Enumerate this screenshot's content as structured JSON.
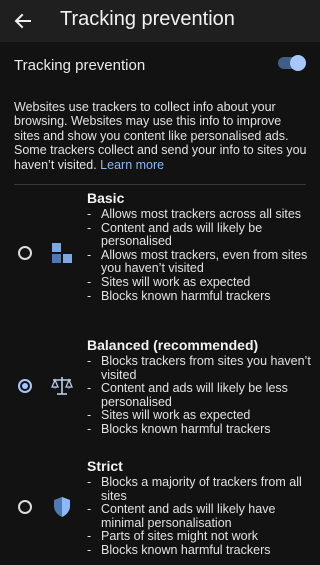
{
  "appbar": {
    "title": "Tracking prevention"
  },
  "toggle": {
    "label": "Tracking prevention",
    "on": true
  },
  "description": {
    "text": "Websites use trackers to collect info about your browsing. Websites may use this info to improve sites and show you content like personalised ads. Some trackers collect and send your info to sites you haven’t visited.",
    "link": "Learn more"
  },
  "options": [
    {
      "title": "Basic",
      "selected": false,
      "icon": "blocks-icon",
      "items": [
        "Allows most trackers across all sites",
        "Content and ads will likely be personalised",
        "Allows most trackers, even from sites you haven’t visited",
        "Sites will work as expected",
        "Blocks known harmful trackers"
      ]
    },
    {
      "title": "Balanced (recommended)",
      "selected": true,
      "icon": "scales-icon",
      "items": [
        "Blocks trackers from sites you haven’t visited",
        "Content and ads will likely be less personalised",
        "Sites will work as expected",
        "Blocks known harmful trackers"
      ]
    },
    {
      "title": "Strict",
      "selected": false,
      "icon": "shield-icon",
      "items": [
        "Blocks a majority of trackers from all sites",
        "Content and ads will likely have minimal personalisation",
        "Parts of sites might not work",
        "Blocks known harmful trackers"
      ]
    }
  ],
  "colors": {
    "background": "#121212",
    "appbar": "#1f1f1f",
    "accent": "#a7c7fb",
    "link": "#8db8f5"
  }
}
